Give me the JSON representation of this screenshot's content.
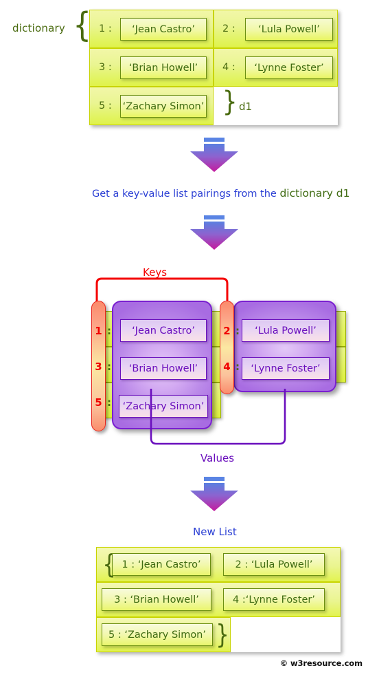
{
  "diagram": {
    "title_label": "dictionary",
    "dict_var_label": "d1",
    "open_brace": "{",
    "close_brace": "}",
    "step_text_prefix": "Get a key-value list pairings from the ",
    "step_text_emphasis": "dictionary d1",
    "keys_label": "Keys",
    "values_label": "Values",
    "new_list_label": "New List",
    "copyright": "© w3resource.com",
    "colon": ":"
  },
  "colors": {
    "yellow_cell": "#e3f46b",
    "yellow_box_border": "#6b8e11",
    "green_text": "#3f6b12",
    "purple_border": "#6a0fbd",
    "purple_fill": "#bb8ae9",
    "key_red": "#f40000",
    "key_pill_orange": "#fb8a6b",
    "blue_text": "#2b3fd4",
    "arrow_top": "#5a7fe0",
    "arrow_bottom": "#c41a9e"
  },
  "dictionary": {
    "entries": [
      {
        "key": "1",
        "value": "‘Jean Castro’"
      },
      {
        "key": "2",
        "value": "‘Lula Powell’"
      },
      {
        "key": "3",
        "value": "‘Brian Howell’"
      },
      {
        "key": "4",
        "value": "‘Lynne Foster’"
      },
      {
        "key": "5",
        "value": "‘Zachary Simon’"
      }
    ]
  },
  "keys_values": {
    "column_left": {
      "keys": [
        "1",
        "3",
        "5"
      ],
      "values": [
        "‘Jean Castro’",
        "‘Brian Howell’",
        "‘Zachary Simon’"
      ]
    },
    "column_right": {
      "keys": [
        "2",
        "4"
      ],
      "values": [
        "‘Lula Powell’",
        "‘Lynne Foster’"
      ]
    }
  },
  "new_list": {
    "items": [
      "1 : ‘Jean Castro’",
      "2 :  ‘Lula Powell’",
      "3 : ‘Brian Howell’",
      "4 :‘Lynne Foster’",
      "5 : ‘Zachary Simon’"
    ]
  }
}
